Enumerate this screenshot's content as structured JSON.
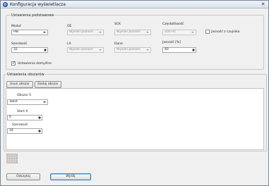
{
  "window": {
    "title": "Konfiguracja wyświetlacza",
    "close_glyph": "✕"
  },
  "basic": {
    "title": "Ustawienia podstawowe",
    "module": {
      "label": "Moduł",
      "value": "PIB"
    },
    "oe": {
      "label": "OE",
      "value": "Wysoki poziom"
    },
    "sck": {
      "label": "SCK",
      "value": "Wysoki poziom"
    },
    "freq": {
      "label": "Częstotliwość",
      "value": "200 Hz"
    },
    "brightness_checkbox": {
      "label": "Jasność z czujnika"
    },
    "width": {
      "label": "Szerokość",
      "value": "32"
    },
    "la": {
      "label": "LA",
      "value": "Wysoki poziom"
    },
    "data": {
      "label": "Dane",
      "value": "Wysoki poziom"
    },
    "brightness": {
      "label": "Jasność [%]",
      "value": "40"
    },
    "defaults_checkbox": {
      "label": "Ustawienia domyślne",
      "checked": true
    }
  },
  "objects": {
    "title": "Ustawienia obszarów",
    "remove_button": "Usuń obszar",
    "add_button": "Dodaj obszar",
    "area": {
      "title": "Obszar 0",
      "type_value": "Tekst",
      "start_x_label": "Start X",
      "start_x_value": "0",
      "width_label": "Szerokość",
      "width_value": "16"
    }
  },
  "footer": {
    "read_button": "Odczytaj",
    "send_button": "Wyślij"
  },
  "colors": {
    "preview_red": "#d23a3a",
    "preview_gray": "#9a9a9a"
  }
}
